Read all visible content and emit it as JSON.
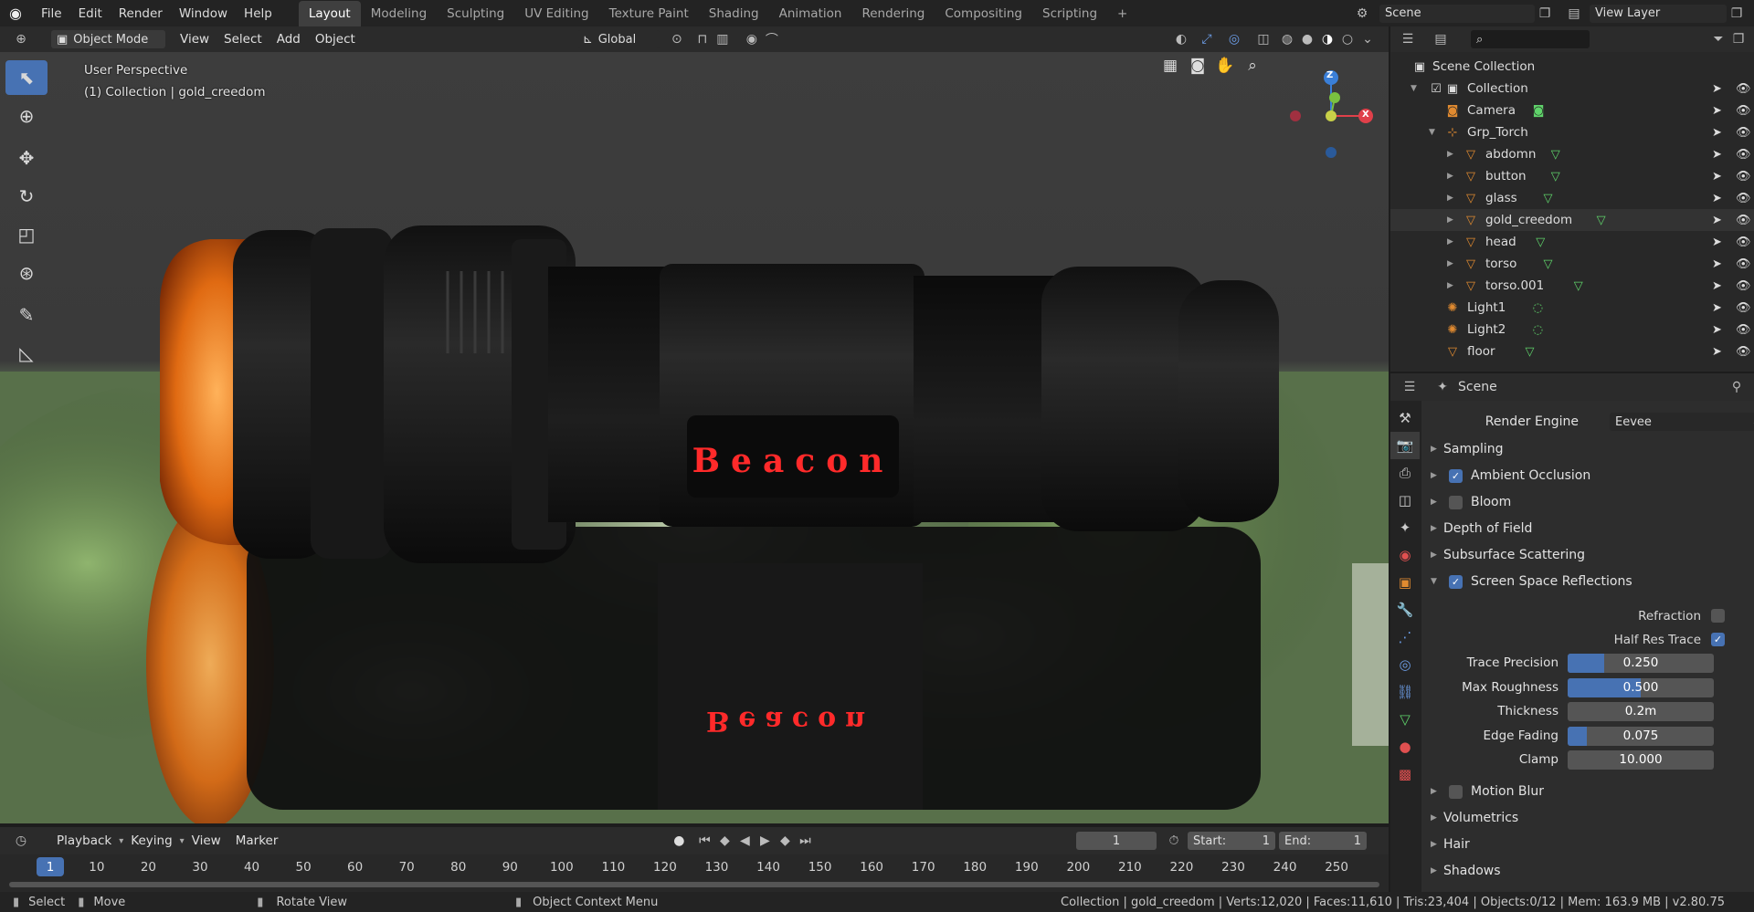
{
  "menus": [
    "File",
    "Edit",
    "Render",
    "Window",
    "Help"
  ],
  "workspaces": [
    "Layout",
    "Modeling",
    "Sculpting",
    "UV Editing",
    "Texture Paint",
    "Shading",
    "Animation",
    "Rendering",
    "Compositing",
    "Scripting"
  ],
  "add_workspace": "+",
  "scene_name": "Scene",
  "view_layer": "View Layer",
  "viewport_header": {
    "mode": "Object Mode",
    "menus": [
      "View",
      "Select",
      "Add",
      "Object"
    ],
    "orientation": "Global"
  },
  "overlay": {
    "perspective": "User Perspective",
    "collection": "(1) Collection | gold_creedom"
  },
  "gizmo": {
    "z": "Z",
    "x": "X"
  },
  "label_text": "Beacon",
  "outliner": {
    "title": "Scene Collection",
    "search_placeholder": "",
    "items": [
      {
        "label": "Collection",
        "icon": "collection-icon"
      },
      {
        "label": "Camera",
        "icon": "camera-icon"
      },
      {
        "label": "Grp_Torch",
        "icon": "empty-icon"
      },
      {
        "label": "abdomn",
        "icon": "mesh-icon"
      },
      {
        "label": "button",
        "icon": "mesh-icon"
      },
      {
        "label": "glass",
        "icon": "mesh-icon"
      },
      {
        "label": "gold_creedom",
        "icon": "mesh-icon"
      },
      {
        "label": "head",
        "icon": "mesh-icon"
      },
      {
        "label": "torso",
        "icon": "mesh-icon"
      },
      {
        "label": "torso.001",
        "icon": "mesh-icon"
      },
      {
        "label": "Light1",
        "icon": "light-icon"
      },
      {
        "label": "Light2",
        "icon": "light-icon"
      },
      {
        "label": "floor",
        "icon": "mesh-icon"
      }
    ]
  },
  "properties": {
    "context": "Scene",
    "render_engine_label": "Render Engine",
    "render_engine": "Eevee",
    "panels": [
      "Sampling",
      "Ambient Occlusion",
      "Bloom",
      "Depth of Field",
      "Subsurface Scattering",
      "Screen Space Reflections"
    ],
    "ssr": {
      "refraction": "Refraction",
      "half_res": "Half Res Trace",
      "rows": [
        {
          "label": "Trace Precision",
          "value": "0.250",
          "fill": 0.25
        },
        {
          "label": "Max Roughness",
          "value": "0.500",
          "fill": 0.5
        },
        {
          "label": "Thickness",
          "value": "0.2m",
          "fill": 0
        },
        {
          "label": "Edge Fading",
          "value": "0.075",
          "fill": 0.13
        },
        {
          "label": "Clamp",
          "value": "10.000",
          "fill": 0
        }
      ]
    },
    "panels_bottom": [
      "Motion Blur",
      "Volumetrics",
      "Hair",
      "Shadows"
    ]
  },
  "timeline": {
    "menus": [
      "Playback",
      "Keying",
      "View",
      "Marker"
    ],
    "current_frame": "1",
    "start_label": "Start:",
    "start": "1",
    "end_label": "End:",
    "end": "1",
    "ticks": [
      "1",
      "10",
      "20",
      "30",
      "40",
      "50",
      "60",
      "70",
      "80",
      "90",
      "100",
      "110",
      "120",
      "130",
      "140",
      "150",
      "160",
      "170",
      "180",
      "190",
      "200",
      "210",
      "220",
      "230",
      "240",
      "250"
    ]
  },
  "status": {
    "select": "Select",
    "move": "Move",
    "rotate": "Rotate View",
    "context": "Object Context Menu",
    "info": "Collection | gold_creedom | Verts:12,020 | Faces:11,610 | Tris:23,404 | Objects:0/12 | Mem: 163.9 MB | v2.80.75"
  }
}
